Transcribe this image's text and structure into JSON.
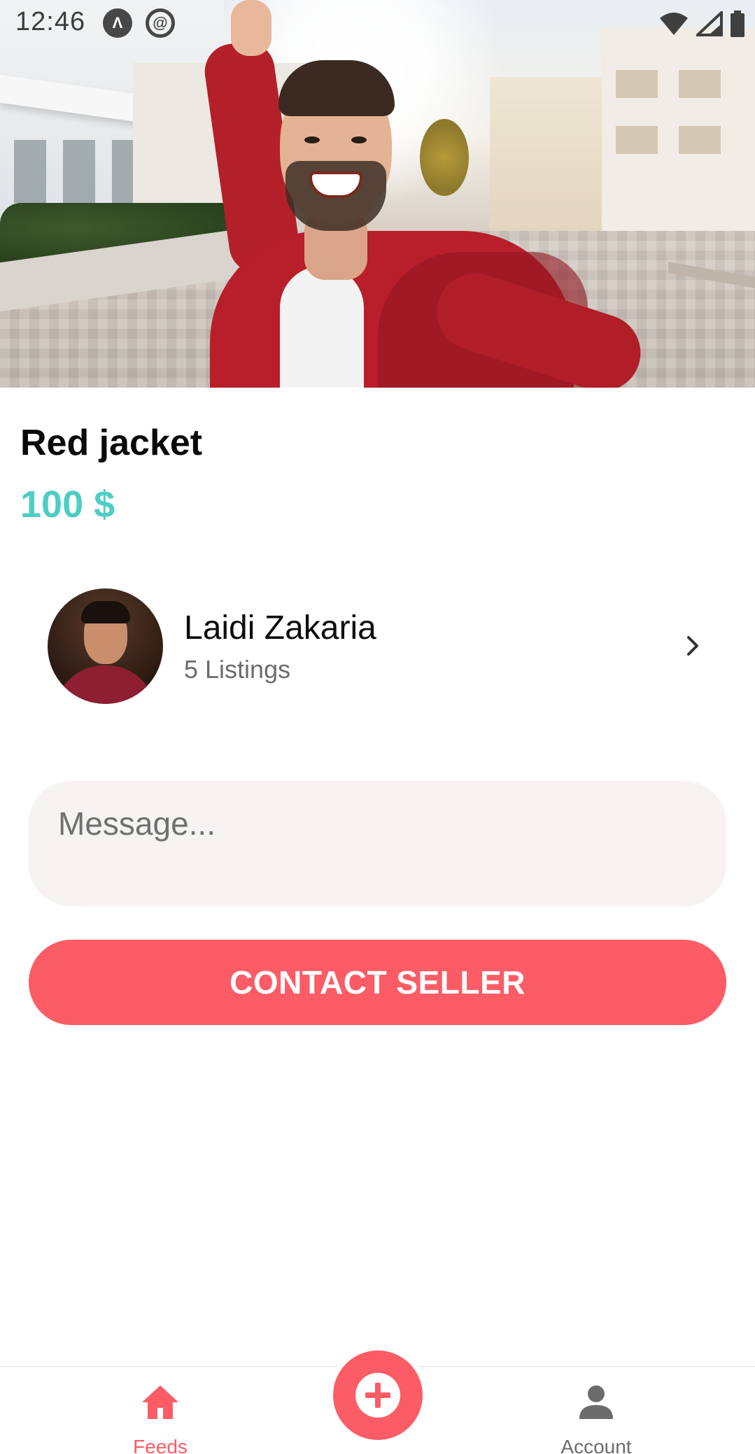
{
  "status_bar": {
    "time": "12:46",
    "icons": [
      "expo-icon",
      "at-sign-icon",
      "wifi-icon",
      "signal-icon",
      "battery-icon"
    ]
  },
  "listing": {
    "title": "Red jacket",
    "price": "100 $",
    "image": "listing-photo"
  },
  "seller": {
    "name": "Laidi Zakaria",
    "listings": "5 Listings"
  },
  "message": {
    "placeholder": "Message...",
    "value": ""
  },
  "contact_button": {
    "label": "CONTACT SELLER"
  },
  "bottom_nav": {
    "feeds_label": "Feeds",
    "account_label": "Account",
    "fab_icon": "plus-circle-icon"
  },
  "colors": {
    "accent": "#fc5c65",
    "price": "#4ecdc4",
    "input_bg": "#f6f3f2"
  }
}
